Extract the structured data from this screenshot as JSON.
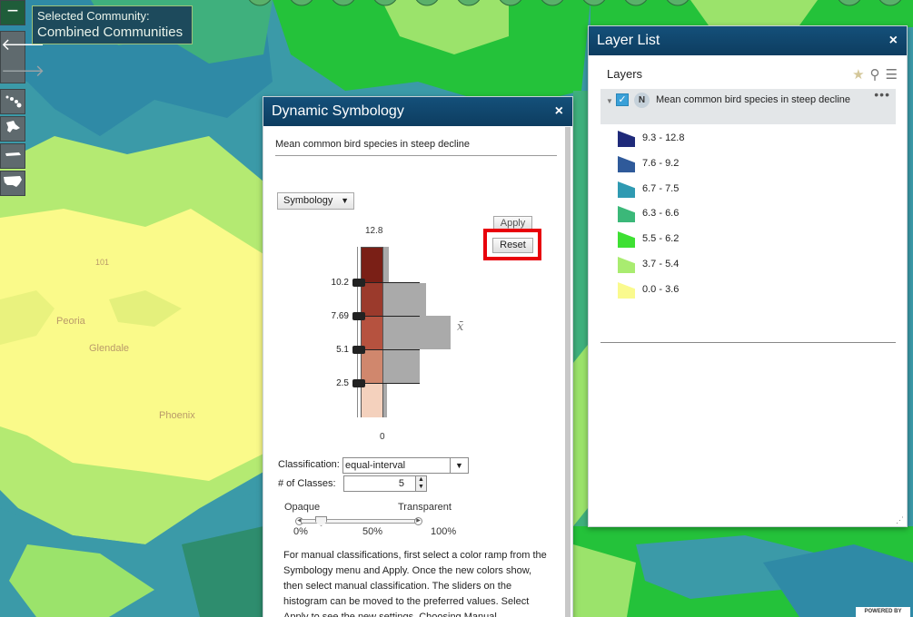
{
  "map": {
    "labels": [
      "Peoria",
      "Glendale",
      "Phoenix",
      "101"
    ],
    "colors": {
      "teal": "#3b9aa8",
      "green": "#22c23a",
      "lightgreen": "#9be36b",
      "yellow": "#fafa8a",
      "blue": "#2a6aa0"
    }
  },
  "controls": {
    "zoom_out": "−",
    "nav_back": "🡐",
    "nav_forward": "🡒"
  },
  "community": {
    "label": "Selected Community:",
    "value": "Combined Communities"
  },
  "dynamic_symbology": {
    "title": "Dynamic Symbology",
    "close": "×",
    "layer_title": "Mean common bird species in steep decline",
    "symbology_dropdown": "Symbology",
    "apply_label": "Apply",
    "reset_label": "Reset",
    "histogram": {
      "max_label": "12.8",
      "min_label": "0",
      "breaks": [
        "10.2",
        "7.69",
        "5.1",
        "2.5"
      ],
      "mean_symbol": "x̄",
      "ramp_colors": [
        "#7a1f16",
        "#9b3a2c",
        "#b6523f",
        "#d0876d",
        "#f4d1bd"
      ],
      "bar_color": "#aaaaaa"
    },
    "classification_label": "Classification:",
    "classification_value": "equal-interval",
    "classes_label": "# of Classes:",
    "classes_value": "5",
    "opaque_label": "Opaque",
    "transparent_label": "Transparent",
    "pct_0": "0%",
    "pct_50": "50%",
    "pct_100": "100%",
    "help_text": "For manual classifications, first select a color ramp from the Symbology menu and Apply. Once the new colors show, then select manual classification. The sliders on the histogram can be moved to the preferred values. Select Apply to see the new settings. Choosing Manual classification first will disable the Symbology menu."
  },
  "layer_list": {
    "title": "Layer List",
    "close": "×",
    "heading": "Layers",
    "layer": {
      "badge": "N",
      "name": "Mean common bird species in steep decline",
      "more": "•••"
    },
    "legend": [
      {
        "label": "9.3 - 12.8",
        "color": "#1f2a7a"
      },
      {
        "label": "7.6 - 9.2",
        "color": "#2f5a9a"
      },
      {
        "label": "6.7 - 7.5",
        "color": "#2f9ab2"
      },
      {
        "label": "6.3 - 6.6",
        "color": "#3bb879"
      },
      {
        "label": "5.5 - 6.2",
        "color": "#3ee033"
      },
      {
        "label": "3.7 - 5.4",
        "color": "#a9ec70"
      },
      {
        "label": "0.0 - 3.6",
        "color": "#fafa8e"
      }
    ]
  },
  "powered_by": "POWERED BY"
}
